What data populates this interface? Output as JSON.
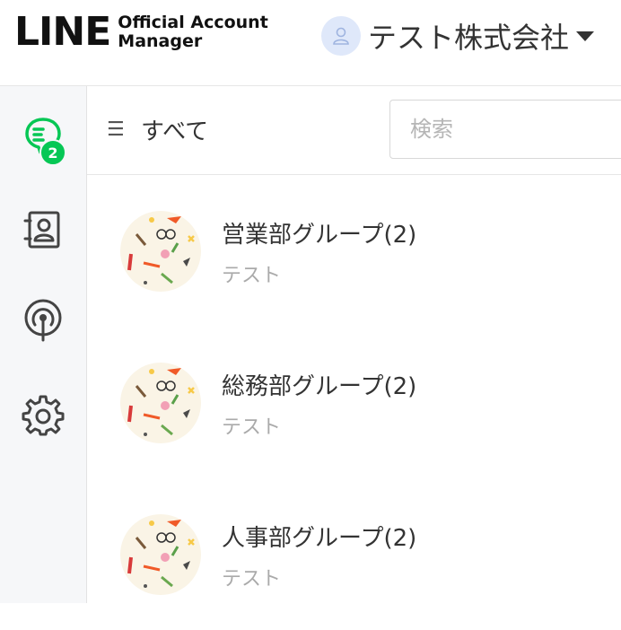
{
  "header": {
    "logo_main": "LINE",
    "logo_sub_1": "Official Account",
    "logo_sub_2": "Manager",
    "account_name": "テスト株式会社"
  },
  "sidebar": {
    "items": [
      {
        "name": "chat",
        "icon": "chat-icon",
        "badge": "2"
      },
      {
        "name": "contacts",
        "icon": "contacts-icon"
      },
      {
        "name": "broadcast",
        "icon": "broadcast-icon"
      },
      {
        "name": "settings",
        "icon": "gear-icon"
      }
    ]
  },
  "toolbar": {
    "filter_label": "すべて",
    "search_placeholder": "検索"
  },
  "chats": [
    {
      "name": "営業部グループ(2)",
      "last_message": "テスト"
    },
    {
      "name": "総務部グループ(2)",
      "last_message": "テスト"
    },
    {
      "name": "人事部グループ(2)",
      "last_message": "テスト"
    }
  ],
  "colors": {
    "accent": "#06c755",
    "sidebar_bg": "#f6f7f9",
    "avatar_bg": "#dfe8fa"
  }
}
